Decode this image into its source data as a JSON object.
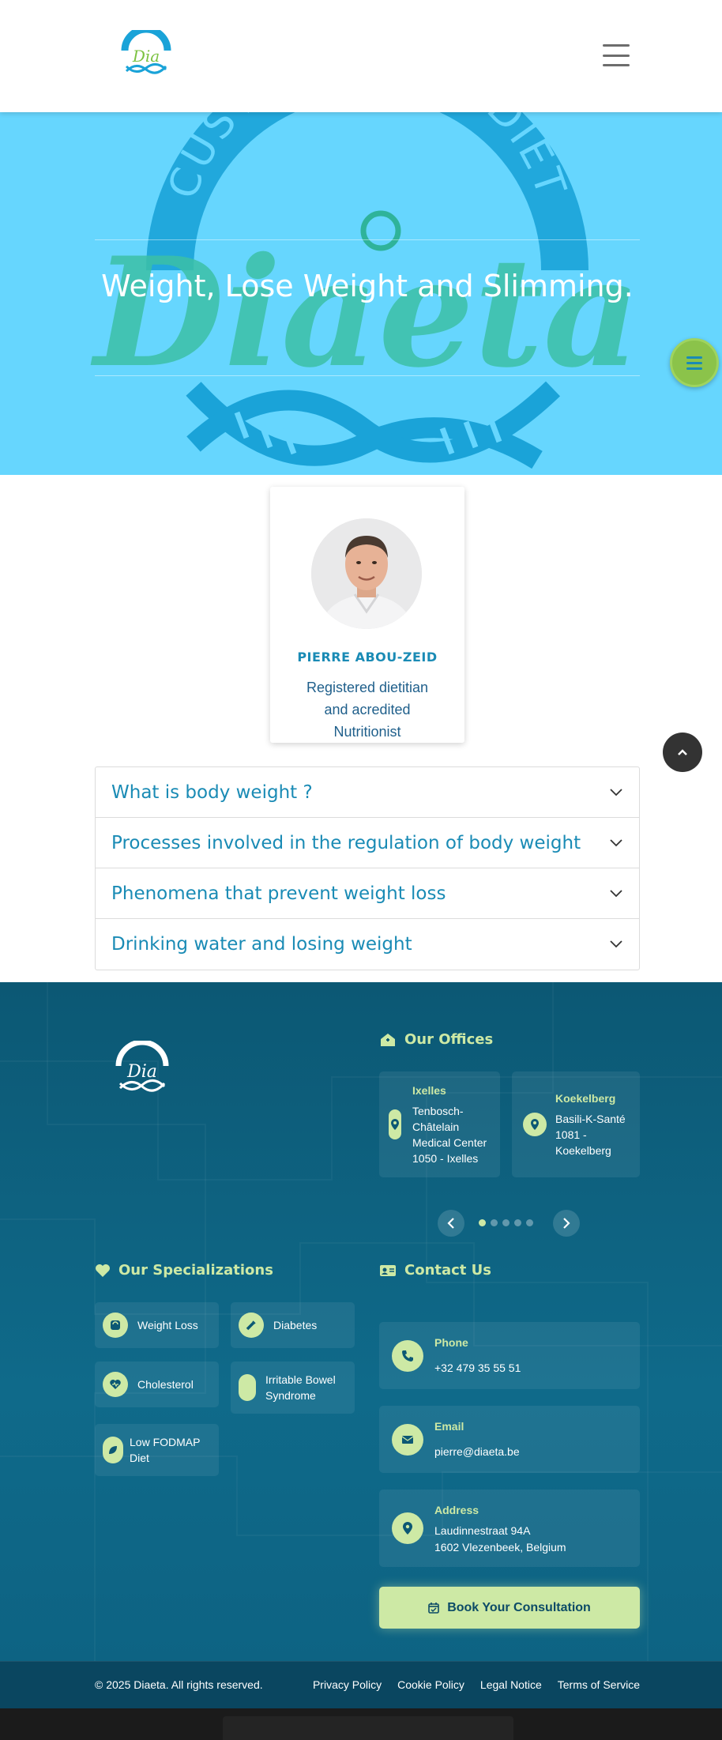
{
  "header": {
    "logo_alt": "Diaeta",
    "menu_icon": "hamburger-icon"
  },
  "hero": {
    "title": "Weight, Lose Weight and Slimming.",
    "watermark_text": "CUSTOM MADE DIET",
    "watermark_brand": "Diaeta"
  },
  "profile": {
    "name": "PIERRE ABOU-ZEID",
    "role": "Registered dietitian and acredited Nutritionist"
  },
  "accordion": [
    {
      "label": "What is body weight ?"
    },
    {
      "label": "Processes involved in the regulation of body weight"
    },
    {
      "label": "Phenomena that prevent weight loss"
    },
    {
      "label": "Drinking water and losing weight"
    }
  ],
  "footer": {
    "offices": {
      "heading": "Our Offices",
      "items": [
        {
          "name": "Ixelles",
          "address": "Tenbosch-Châtelain Medical Center 1050 - Ixelles"
        },
        {
          "name": "Koekelberg",
          "address": "Basili-K-Santé 1081 - Koekelberg"
        }
      ],
      "carousel_pages": 5,
      "active_page": 1
    },
    "specializations": {
      "heading": "Our Specializations",
      "items": [
        {
          "label": "Weight Loss",
          "icon": "scale-icon"
        },
        {
          "label": "Diabetes",
          "icon": "syringe-icon"
        },
        {
          "label": "Cholesterol",
          "icon": "heart-pulse-icon"
        },
        {
          "label": "Irritable Bowel Syndrome",
          "icon": "stomach-icon"
        },
        {
          "label": "Low FODMAP Diet",
          "icon": "leaf-icon"
        }
      ]
    },
    "contact": {
      "heading": "Contact Us",
      "phone_label": "Phone",
      "phone": "+32 479 35 55 51",
      "email_label": "Email",
      "email": "pierre@diaeta.be",
      "address_label": "Address",
      "address_line1": "Laudinnestraat 94A",
      "address_line2": "1602 Vlezenbeek, Belgium"
    },
    "book_button": "Book Your Consultation",
    "copyright": "© 2025 Diaeta. All rights reserved.",
    "legal_links": [
      "Privacy Policy",
      "Cookie Policy",
      "Legal Notice",
      "Terms of Service"
    ]
  },
  "colors": {
    "hero_bg": "#66d6fe",
    "brand_blue": "#1a8bb5",
    "accent_green": "#8bc34a",
    "footer_bg": "#0c5874",
    "footer_accent": "#cde9a5"
  }
}
